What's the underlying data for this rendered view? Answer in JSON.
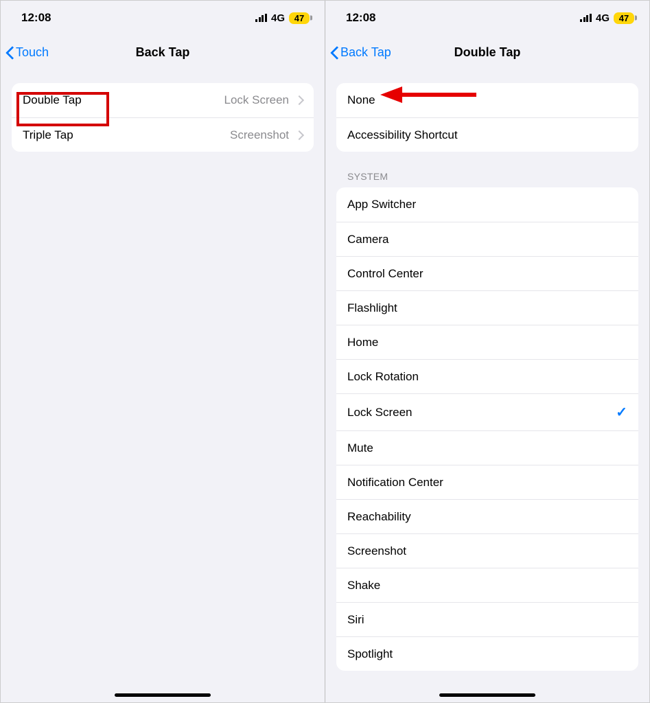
{
  "left": {
    "status": {
      "time": "12:08",
      "network": "4G",
      "battery": "47"
    },
    "nav": {
      "back": "Touch",
      "title": "Back Tap"
    },
    "rows": [
      {
        "label": "Double Tap",
        "value": "Lock Screen"
      },
      {
        "label": "Triple Tap",
        "value": "Screenshot"
      }
    ]
  },
  "right": {
    "status": {
      "time": "12:08",
      "network": "4G",
      "battery": "47"
    },
    "nav": {
      "back": "Back Tap",
      "title": "Double Tap"
    },
    "top_rows": [
      {
        "label": "None"
      },
      {
        "label": "Accessibility Shortcut"
      }
    ],
    "system_header": "System",
    "system_rows": [
      {
        "label": "App Switcher"
      },
      {
        "label": "Camera"
      },
      {
        "label": "Control Center"
      },
      {
        "label": "Flashlight"
      },
      {
        "label": "Home"
      },
      {
        "label": "Lock Rotation"
      },
      {
        "label": "Lock Screen",
        "checked": true
      },
      {
        "label": "Mute"
      },
      {
        "label": "Notification Center"
      },
      {
        "label": "Reachability"
      },
      {
        "label": "Screenshot"
      },
      {
        "label": "Shake"
      },
      {
        "label": "Siri"
      },
      {
        "label": "Spotlight"
      }
    ]
  }
}
